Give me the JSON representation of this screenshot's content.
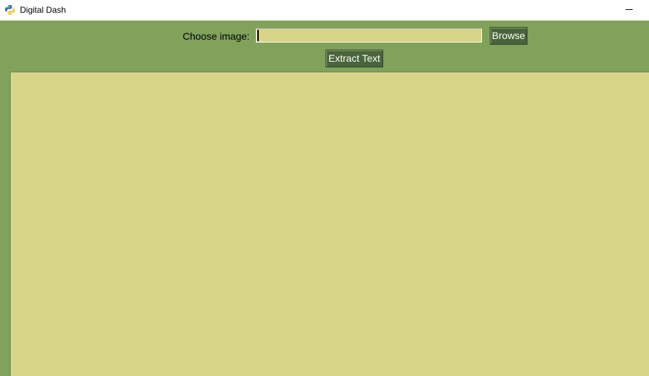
{
  "window": {
    "title": "Digital Dash",
    "app_icon": "python-icon",
    "minimize_icon": "minimize-icon"
  },
  "form": {
    "choose_label": "Choose image:",
    "image_path": "",
    "browse_label": "Browse",
    "extract_label": "Extract Text"
  },
  "output": {
    "text": ""
  },
  "colors": {
    "background": "#80a25a",
    "field": "#d8d488",
    "button": "#49643a",
    "button_text": "#ffffff"
  }
}
